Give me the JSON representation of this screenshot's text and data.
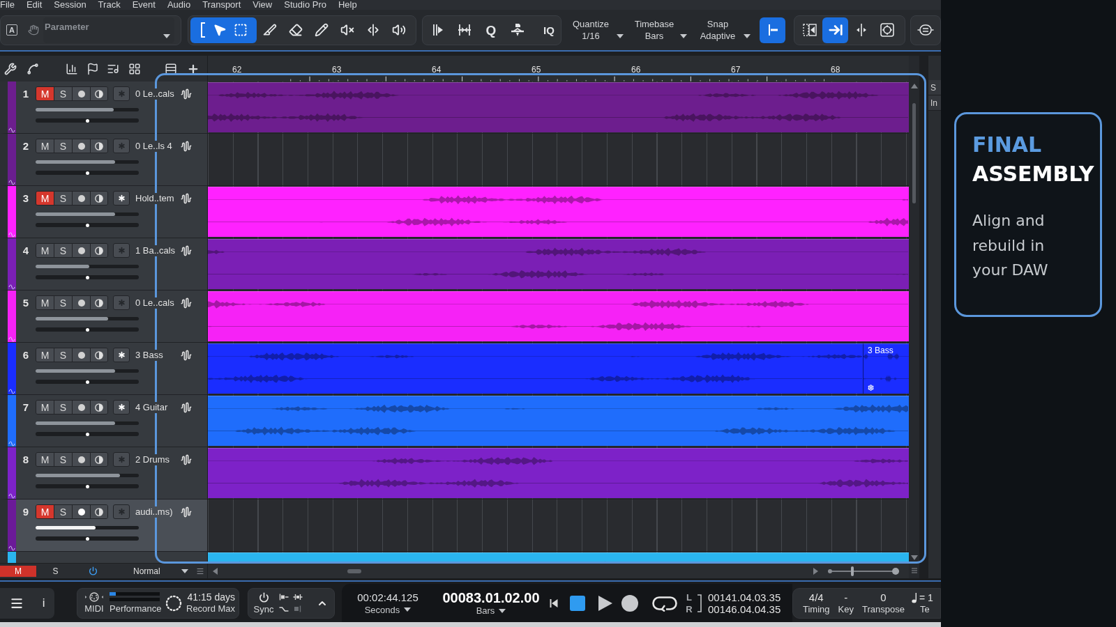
{
  "menu": [
    "File",
    "Edit",
    "Session",
    "Track",
    "Event",
    "Audio",
    "Transport",
    "View",
    "Studio Pro",
    "Help"
  ],
  "toolbar": {
    "format_button": "A",
    "parameter_field": {
      "placeholder": "Parameter"
    },
    "edit_tools": [
      {
        "selected": true
      },
      {
        "selected": false
      },
      {
        "selected": false
      },
      {
        "selected": false
      },
      {
        "selected": false
      },
      {
        "selected": false
      },
      {
        "selected": false
      }
    ],
    "q_button": "Q",
    "iq_button": "IQ",
    "settings": [
      {
        "label": "Quantize",
        "value": "1/16"
      },
      {
        "label": "Timebase",
        "value": "Bars"
      },
      {
        "label": "Snap",
        "value": "Adaptive"
      }
    ],
    "snap_toggle": {
      "selected": true
    },
    "view_tools": [
      {
        "selected": false
      },
      {
        "selected": true
      },
      {
        "selected": false
      },
      {
        "selected": false
      }
    ]
  },
  "ruler": {
    "bars": [
      "62",
      "63",
      "64",
      "65",
      "66",
      "67",
      "68"
    ]
  },
  "tracks": [
    {
      "number": "1",
      "name": "0 Le..cals",
      "color": "#6d1e8e",
      "selected": false,
      "mute": {
        "label": "M",
        "on": true
      },
      "solo": {
        "label": "S",
        "on": false
      },
      "star_on": false,
      "volume": {
        "level": 0.76
      },
      "pan": {
        "level": 0.5
      },
      "events": [
        {
          "kind": "audio"
        }
      ]
    },
    {
      "number": "2",
      "name": "0 Le..ls 4",
      "color": "#6a1e8f",
      "selected": false,
      "mute": {
        "label": "M",
        "on": false
      },
      "solo": {
        "label": "S",
        "on": false
      },
      "star_on": false,
      "volume": {
        "level": 0.77
      },
      "pan": {
        "level": 0.5
      }
    },
    {
      "number": "3",
      "name": "Hold..tem",
      "color": "#ff22ff",
      "selected": false,
      "mute": {
        "label": "M",
        "on": true
      },
      "solo": {
        "label": "S",
        "on": false
      },
      "star_on": true,
      "volume": {
        "level": 0.77
      },
      "pan": {
        "level": 0.5
      },
      "events": [
        {
          "kind": "audio"
        }
      ]
    },
    {
      "number": "4",
      "name": "1 Ba..cals",
      "color": "#7b1fb5",
      "selected": false,
      "mute": {
        "label": "M",
        "on": false
      },
      "solo": {
        "label": "S",
        "on": false
      },
      "star_on": false,
      "volume": {
        "level": 0.52
      },
      "pan": {
        "level": 0.5
      },
      "events": [
        {
          "kind": "audio"
        }
      ]
    },
    {
      "number": "5",
      "name": "0 Le..cals",
      "color": "#f622f6",
      "selected": false,
      "mute": {
        "label": "M",
        "on": false
      },
      "solo": {
        "label": "S",
        "on": false
      },
      "star_on": false,
      "volume": {
        "level": 0.7
      },
      "pan": {
        "level": 0.5
      },
      "events": [
        {
          "kind": "audio"
        }
      ]
    },
    {
      "number": "6",
      "name": "3 Bass",
      "color": "#1a2dff",
      "selected": false,
      "mute": {
        "label": "M",
        "on": false
      },
      "solo": {
        "label": "S",
        "on": false
      },
      "star_on": true,
      "volume": {
        "level": 0.77
      },
      "pan": {
        "level": 0.5
      },
      "events": [
        {
          "kind": "audio"
        },
        {
          "kind": "audio",
          "label": "3 Bass"
        }
      ]
    },
    {
      "number": "7",
      "name": "4 Guitar",
      "color": "#1f6dfc",
      "selected": false,
      "mute": {
        "label": "M",
        "on": false
      },
      "solo": {
        "label": "S",
        "on": false
      },
      "star_on": true,
      "volume": {
        "level": 0.77
      },
      "pan": {
        "level": 0.5
      },
      "events": [
        {
          "kind": "audio"
        }
      ]
    },
    {
      "number": "8",
      "name": "2 Drums",
      "color": "#7d22c8",
      "selected": false,
      "mute": {
        "label": "M",
        "on": false
      },
      "solo": {
        "label": "S",
        "on": false
      },
      "star_on": false,
      "volume": {
        "level": 0.82
      },
      "pan": {
        "level": 0.5
      },
      "events": [
        {
          "kind": "audio"
        }
      ]
    },
    {
      "number": "9",
      "name": "audi..ms)",
      "color": "#6b1a98",
      "selected": true,
      "mute": {
        "label": "M",
        "on": true
      },
      "solo": {
        "label": "S",
        "on": false
      },
      "star_on": false,
      "volume": {
        "level": 0.58
      },
      "pan": {
        "level": 0.5
      }
    },
    {
      "color": "#2ab5ef",
      "selected": false,
      "events": [
        {
          "kind": "audio"
        }
      ]
    }
  ],
  "arrange_footer": {
    "mute_indicator": {
      "label": "M",
      "on": true
    },
    "solo_indicator": {
      "label": "S"
    },
    "power": {
      "on": true
    },
    "mode": "Normal",
    "zoom": {
      "level": 0.34
    }
  },
  "side_panel": {
    "tabs": [
      "S",
      "In"
    ]
  },
  "transport": {
    "info_button": "i",
    "midi_label": "MIDI",
    "performance": {
      "label": "Performance",
      "level": 0.13
    },
    "record_max": {
      "value": "41:15 days",
      "label": "Record Max"
    },
    "sync_label": "Sync",
    "seconds": {
      "value": "00:02:44.125",
      "format": "Seconds"
    },
    "bars": {
      "value": "00083.01.02.00",
      "format": "Bars"
    },
    "stop": {
      "on": true
    },
    "loop_range": [
      {
        "label": "L",
        "value": "00141.04.03.35"
      },
      {
        "label": "R",
        "value": "00146.04.04.35"
      }
    ],
    "song": [
      {
        "kind": "text",
        "value": "4/4",
        "label": "Timing"
      },
      {
        "kind": "text",
        "value": "-",
        "label": "Key"
      },
      {
        "kind": "text",
        "value": "0",
        "label": "Transpose"
      },
      {
        "kind": "tempo",
        "value": "= 1",
        "label": "Te"
      }
    ]
  },
  "card": {
    "title_accent": "FINAL",
    "title": "ASSEMBLY",
    "body": "Align and rebuild in your DAW"
  }
}
